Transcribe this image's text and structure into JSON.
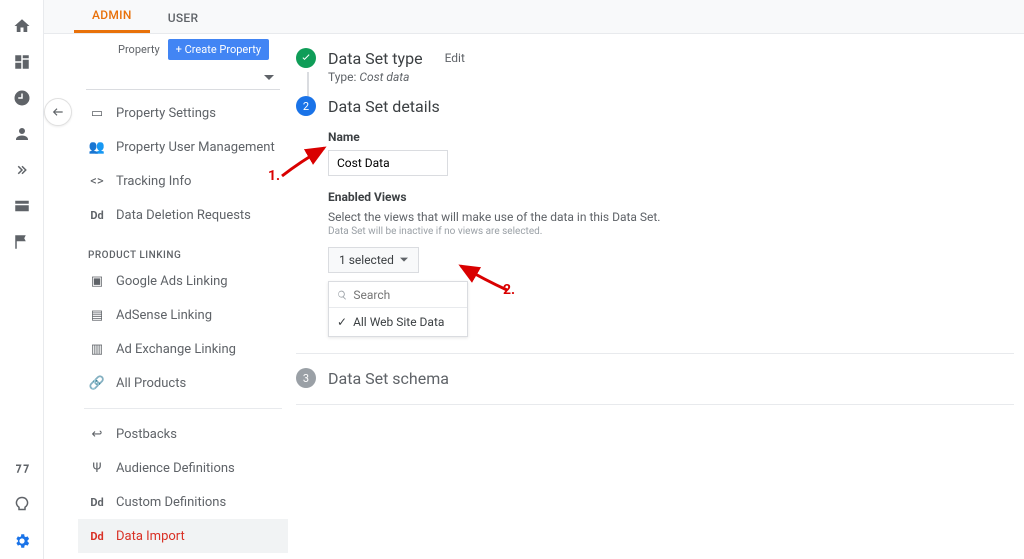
{
  "tabs": {
    "admin": "ADMIN",
    "user": "USER"
  },
  "property": {
    "label": "Property",
    "create_btn": "+   Create Property"
  },
  "sidenav": {
    "settings": "Property Settings",
    "user_mgmt": "Property User Management",
    "tracking": "Tracking Info",
    "deletion": "Data Deletion Requests",
    "linking_header": "PRODUCT LINKING",
    "ads": "Google Ads Linking",
    "adsense": "AdSense Linking",
    "adexchange": "Ad Exchange Linking",
    "allproducts": "All Products",
    "postbacks": "Postbacks",
    "audience": "Audience Definitions",
    "custom": "Custom Definitions",
    "dataimport": "Data Import"
  },
  "steps": {
    "s1_title": "Data Set type",
    "s1_edit": "Edit",
    "s1_type_label": "Type: ",
    "s1_type_value": "Cost data",
    "s2_num": "2",
    "s2_title": "Data Set details",
    "name_label": "Name",
    "name_value": "Cost Data",
    "views_label": "Enabled Views",
    "views_help": "Select the views that will make use of the data in this Data Set.",
    "views_help2": "Data Set will be inactive if no views are selected.",
    "selected_btn": "1 selected",
    "search_placeholder": "Search",
    "option1": "All Web Site Data",
    "s3_num": "3",
    "s3_title": "Data Set schema"
  },
  "annotations": {
    "n1": "1.",
    "n2": "2."
  }
}
